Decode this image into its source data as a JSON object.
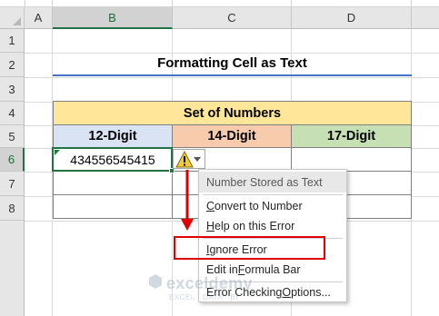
{
  "columns": [
    "A",
    "B",
    "C",
    "D"
  ],
  "rows": [
    "1",
    "2",
    "3",
    "4",
    "5",
    "6",
    "7",
    "8"
  ],
  "title": "Formatting Cell as Text",
  "table": {
    "header": "Set of Numbers",
    "col_headers": [
      "12-Digit",
      "14-Digit",
      "17-Digit"
    ],
    "col_colors": [
      "#dae3f3",
      "#f8cbad",
      "#c6e0b4"
    ],
    "cell_b6": "434556545415"
  },
  "error_menu": {
    "title": "Number Stored as Text",
    "items": [
      {
        "pre": "",
        "u": "C",
        "post": "onvert to Number"
      },
      {
        "pre": "",
        "u": "H",
        "post": "elp on this Error"
      },
      {
        "pre": "",
        "u": "I",
        "post": "gnore Error"
      },
      {
        "pre": "Edit in ",
        "u": "F",
        "post": "ormula Bar"
      },
      {
        "pre": "Error Checking ",
        "u": "O",
        "post": "ptions..."
      }
    ]
  },
  "annotation": {
    "arrow_color": "#e00000",
    "highlight_color": "#e00000"
  },
  "watermark": {
    "name": "exceldemy",
    "tagline": "EXCEL · DATA · BI"
  }
}
